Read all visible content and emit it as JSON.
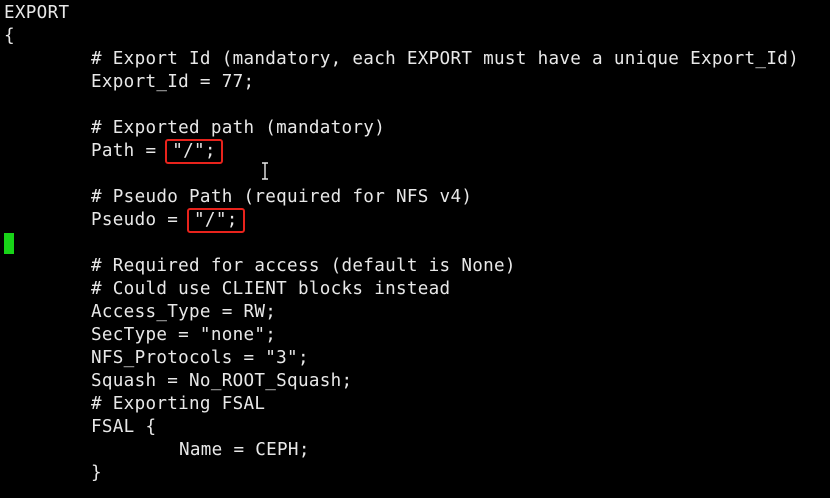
{
  "editor": {
    "lines": {
      "l1": "EXPORT",
      "l2": "{",
      "l3": "# Export Id (mandatory, each EXPORT must have a unique Export_Id)",
      "l4": "Export_Id = 77;",
      "l5": "",
      "l6": "# Exported path (mandatory)",
      "l7_prefix": "Path = ",
      "l7_value": "\"/\";",
      "l8": "",
      "l9": "# Pseudo Path (required for NFS v4)",
      "l10_prefix": "Pseudo = ",
      "l10_value": "\"/\";",
      "l11": "",
      "l12": "# Required for access (default is None)",
      "l13": "# Could use CLIENT blocks instead",
      "l14": "Access_Type = RW;",
      "l15": "SecType = \"none\";",
      "l16": "NFS_Protocols = \"3\";",
      "l17": "Squash = No_ROOT_Squash;",
      "l18": "# Exporting FSAL",
      "l19": "FSAL {",
      "l20": "Name = CEPH;",
      "l21": "}"
    }
  },
  "colors": {
    "background": "#000000",
    "text": "#e8e8e8",
    "highlight_box": "#e8231c",
    "cursor": "#18d418"
  },
  "icons": {
    "mouse_pointer": "text-cursor-icon"
  }
}
